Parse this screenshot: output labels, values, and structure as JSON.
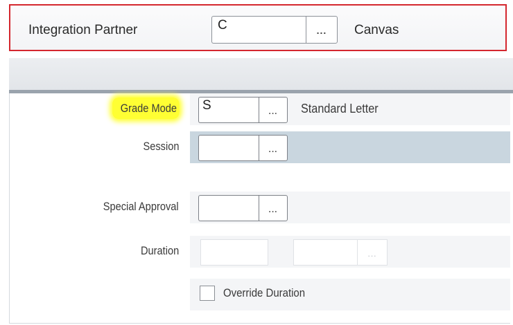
{
  "integration_partner": {
    "label": "Integration Partner",
    "code_value": "C",
    "lookup_glyph": "...",
    "description": "Canvas"
  },
  "fields": {
    "grade_mode": {
      "label": "Grade Mode",
      "code_value": "S",
      "lookup_glyph": "...",
      "description": "Standard Letter"
    },
    "session": {
      "label": "Session",
      "code_value": "",
      "lookup_glyph": "..."
    },
    "special_approval": {
      "label": "Special Approval",
      "code_value": "",
      "lookup_glyph": "..."
    },
    "duration": {
      "label": "Duration",
      "lookup_glyph": "..."
    },
    "override_duration": {
      "label": "Override Duration",
      "checked": false
    }
  },
  "colors": {
    "highlight": "#ffff33",
    "partner_border": "#d4272e",
    "selected_row": "#c9d6df"
  }
}
